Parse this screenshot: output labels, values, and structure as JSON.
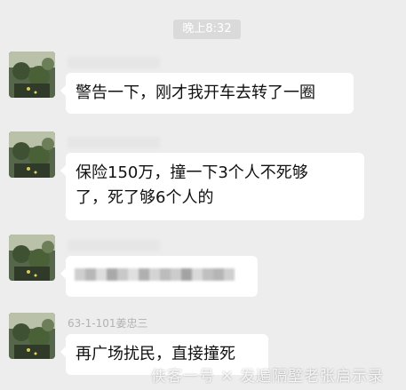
{
  "timestamp": "晚上8:32",
  "messages": [
    {
      "sender": "",
      "text": "警告一下，刚才我开车去转了一圈"
    },
    {
      "sender": "",
      "text": "保险150万，撞一下3个人不死够\n了，死了够6个人的"
    },
    {
      "sender": "",
      "text": ""
    },
    {
      "sender": "63-1-101姜忠三",
      "text": "再广场扰民，直接撞死"
    }
  ],
  "watermark": "侠客一号 ✕ 发遍隔壁老张启示录",
  "colors": {
    "background": "#ededed",
    "bubble": "#ffffff",
    "time_badge": "#dadada",
    "sender_text": "#b2b2b2"
  }
}
